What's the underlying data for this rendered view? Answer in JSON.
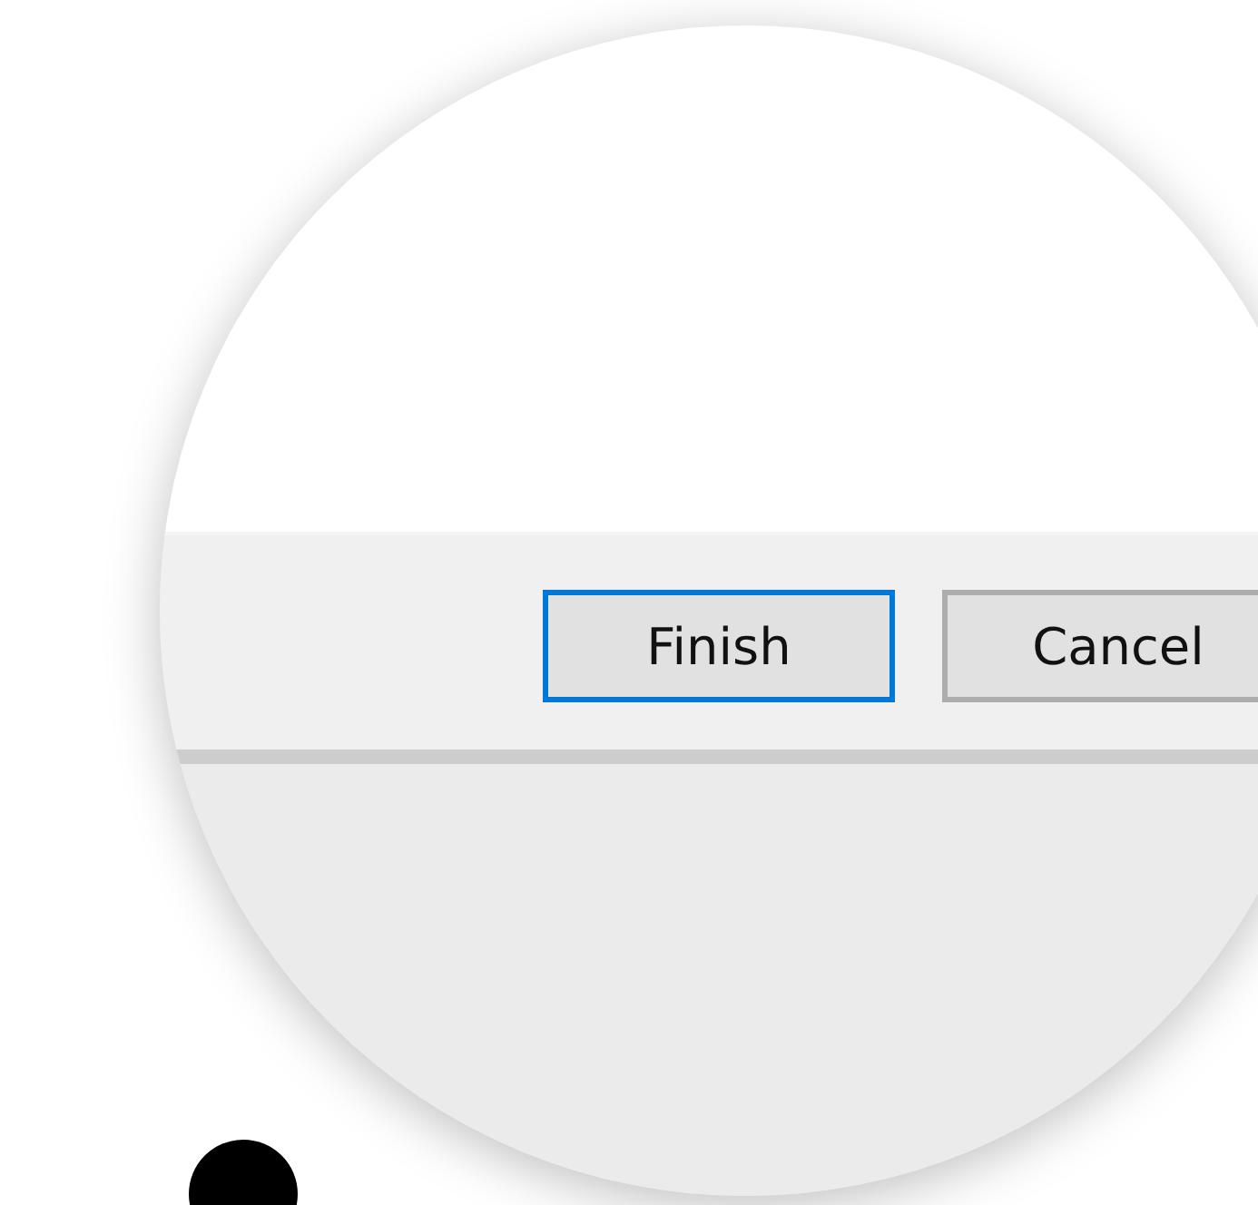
{
  "dialog_footer": {
    "buttons": [
      {
        "label": "Finish",
        "focused": true
      },
      {
        "label": "Cancel",
        "focused": false
      }
    ]
  }
}
